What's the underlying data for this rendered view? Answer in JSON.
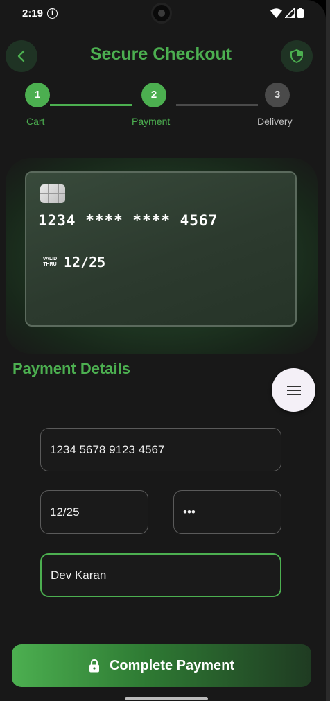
{
  "status_bar": {
    "time": "2:19"
  },
  "header": {
    "title": "Secure Checkout"
  },
  "stepper": {
    "steps": [
      {
        "number": "1",
        "label": "Cart"
      },
      {
        "number": "2",
        "label": "Payment"
      },
      {
        "number": "3",
        "label": "Delivery"
      }
    ]
  },
  "card_preview": {
    "number": "1234 **** **** 4567",
    "valid_label_1": "VALID",
    "valid_label_2": "THRU",
    "expiry": "12/25"
  },
  "payment_details": {
    "title": "Payment Details",
    "card_number_value": "1234 5678 9123 4567",
    "expiry_value": "12/25",
    "cvv_value": "•••",
    "name_value": "Dev Karan"
  },
  "pay_button": {
    "label": "Complete Payment"
  },
  "colors": {
    "accent": "#4caf50",
    "background": "#181818",
    "inactive_step": "#4a4a4a"
  }
}
